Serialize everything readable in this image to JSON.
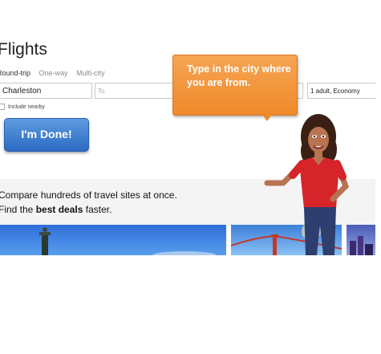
{
  "page": {
    "title": "Flights"
  },
  "trip_types": [
    {
      "label": "Round-trip"
    },
    {
      "label": "One-way"
    },
    {
      "label": "Multi-city"
    }
  ],
  "search": {
    "from_value": "Charleston",
    "to_placeholder": "To",
    "passengers_value": "1 adult, Economy",
    "include_nearby_label": "Include nearby"
  },
  "done_button": {
    "label": "I'm Done!"
  },
  "callout": {
    "text": "Type in the city where you are from."
  },
  "promo": {
    "line1": "Compare hundreds of travel sites at once.",
    "line2_prefix": "Find the ",
    "line2_bold": "best deals",
    "line2_suffix": " faster."
  },
  "colors": {
    "done_button": "#3a7bd5",
    "callout": "#f29a3b",
    "shirt": "#d6242b"
  }
}
